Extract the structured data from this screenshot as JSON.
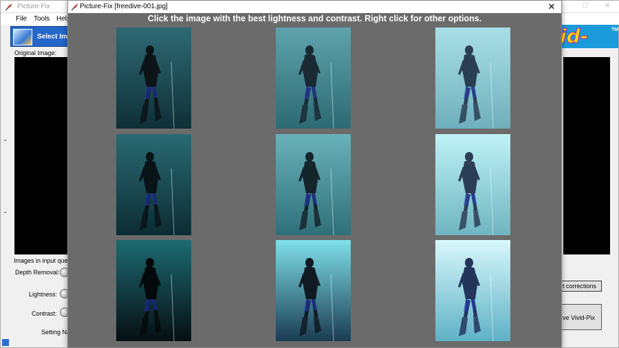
{
  "main_window": {
    "title": "Picture-Fix",
    "menu": [
      "File",
      "Tools",
      "Help"
    ],
    "select_image_label": "Select Imag",
    "original_image_label": "Original Image:",
    "queue_label": "Images in input queue:",
    "depth_removal_label": "Depth Removal:",
    "lightness_label": "Lightness:",
    "contrast_label": "Contrast:",
    "setting_label": "Setting Nam",
    "brand_text": "id-Pix",
    "brand_tm": "TM",
    "corrections_button": "t corrections",
    "save_button": "ve Vivid-Pix"
  },
  "dialog": {
    "title": "Picture-Fix  [freedive-001.jpg]",
    "close_glyph": "✕",
    "instruction": "Click the image with the best lightness and contrast.  Right click for other options.",
    "thumbnails": [
      {
        "row": 1,
        "col": 1,
        "top": "#2e6a74",
        "bottom": "#0f2f36",
        "diver": "#0c1417"
      },
      {
        "row": 1,
        "col": 2,
        "top": "#5fa3ac",
        "bottom": "#2d6a73",
        "diver": "#1a2a33"
      },
      {
        "row": 1,
        "col": 3,
        "top": "#a9dfe6",
        "bottom": "#6fb0bc",
        "diver": "#2a3f52"
      },
      {
        "row": 2,
        "col": 1,
        "top": "#2a6a73",
        "bottom": "#0c2c33",
        "diver": "#091417"
      },
      {
        "row": 2,
        "col": 2,
        "top": "#6ab2ba",
        "bottom": "#2f6f79",
        "diver": "#15252c"
      },
      {
        "row": 2,
        "col": 3,
        "top": "#bff2f6",
        "bottom": "#6fb5c0",
        "diver": "#2b3e55"
      },
      {
        "row": 3,
        "col": 1,
        "top": "#1d6a72",
        "bottom": "#050f12",
        "diver": "#040a0c"
      },
      {
        "row": 3,
        "col": 2,
        "top": "#7fe0ea",
        "bottom": "#1a3c52",
        "diver": "#0f1a22"
      },
      {
        "row": 3,
        "col": 3,
        "top": "#d8f8fb",
        "bottom": "#5fb1c6",
        "diver": "#23355a"
      }
    ]
  }
}
